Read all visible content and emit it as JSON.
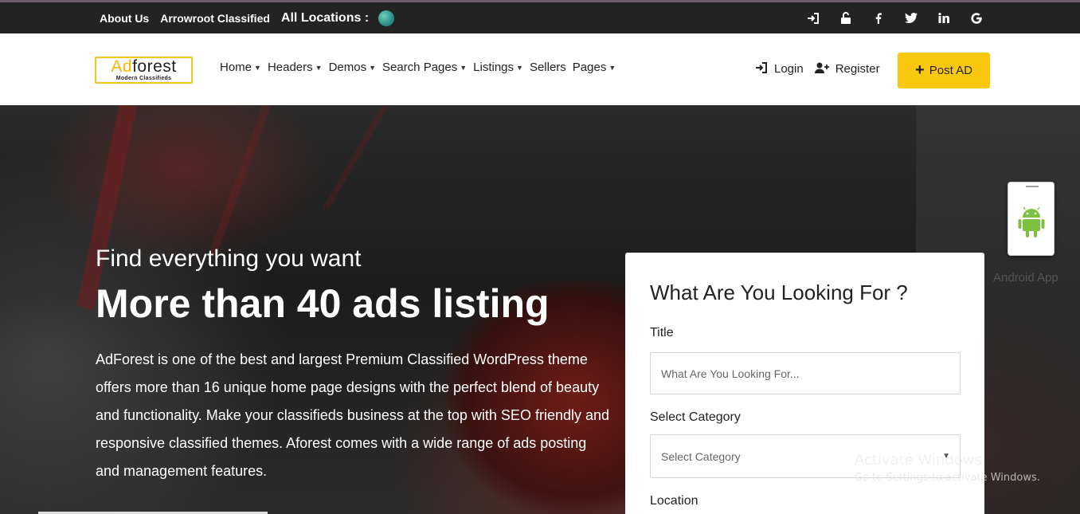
{
  "topbar": {
    "about": "About Us",
    "classified": "Arrowroot Classified",
    "locations": "All Locations :",
    "icons": [
      "sign-in-icon",
      "unlock-icon",
      "facebook-icon",
      "twitter-icon",
      "linkedin-icon",
      "google-icon"
    ]
  },
  "header": {
    "logo_ad": "Ad",
    "logo_forest": "forest",
    "logo_tagline": "Modern Classifieds",
    "nav": [
      {
        "label": "Home",
        "has_dropdown": true
      },
      {
        "label": "Headers",
        "has_dropdown": true
      },
      {
        "label": "Demos",
        "has_dropdown": true
      },
      {
        "label": "Search Pages",
        "has_dropdown": true
      },
      {
        "label": "Listings",
        "has_dropdown": true
      },
      {
        "label": "Sellers",
        "has_dropdown": false
      },
      {
        "label": "Pages",
        "has_dropdown": true
      }
    ],
    "login": "Login",
    "register": "Register",
    "post_ad": "Post AD",
    "accent": "#f9c80e"
  },
  "hero": {
    "tagline": "Find everything you want",
    "title": "More than 40 ads listing",
    "description": "AdForest is one of the best and largest Premium Classified WordPress theme offers more than 16 unique home page designs with the perfect blend of beauty and functionality. Make your classifieds business at the top with SEO friendly and responsive classified themes. Aforest comes with a wide range of ads posting and management features."
  },
  "search_card": {
    "heading": "What Are You Looking For ?",
    "title_label": "Title",
    "title_placeholder": "What Are You Looking For...",
    "category_label": "Select Category",
    "category_value": "Select Category",
    "location_label": "Location"
  },
  "app_widget": {
    "label": "Android App"
  },
  "watermark": {
    "line1": "Activate Windows",
    "line2": "Go to Settings to activate Windows."
  }
}
